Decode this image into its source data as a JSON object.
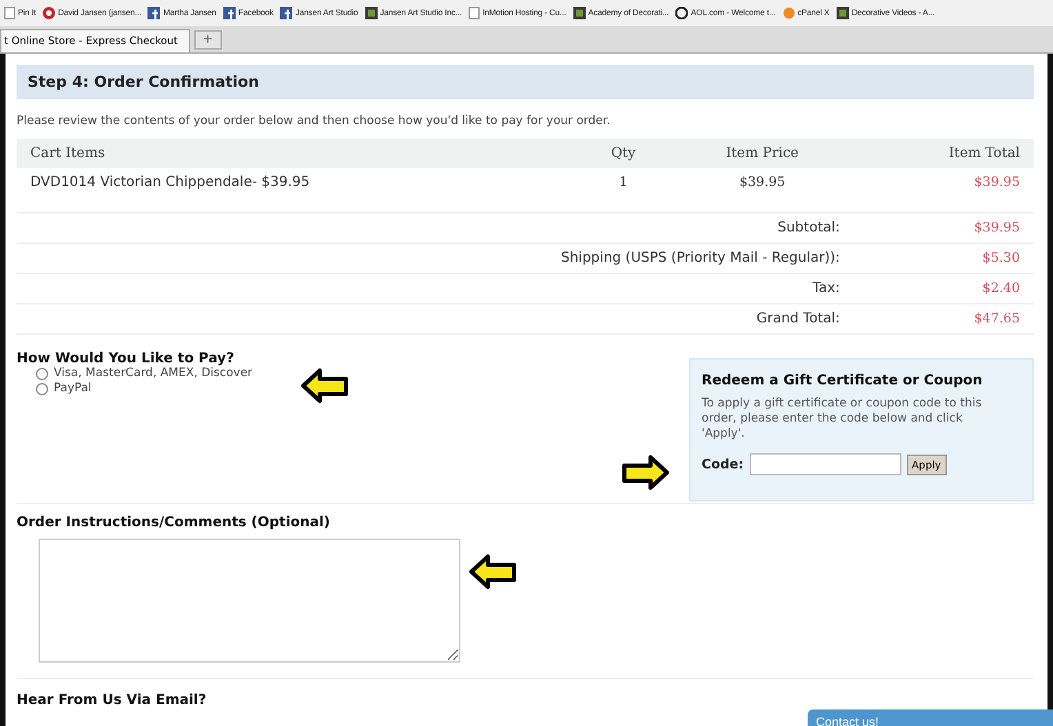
{
  "bookmarks": [
    {
      "label": "Pin It",
      "kind": "blank"
    },
    {
      "label": "David Jansen (jansen...",
      "kind": "pin"
    },
    {
      "label": "Martha Jansen",
      "kind": "facebook"
    },
    {
      "label": "Facebook",
      "kind": "facebook"
    },
    {
      "label": "Jansen Art Studio",
      "kind": "facebook"
    },
    {
      "label": "Jansen Art Studio Inc...",
      "kind": "site"
    },
    {
      "label": "InMotion Hosting - Cu...",
      "kind": "blank"
    },
    {
      "label": "Academy of Decorati...",
      "kind": "site"
    },
    {
      "label": "AOL.com - Welcome t...",
      "kind": "aol"
    },
    {
      "label": "cPanel X",
      "kind": "cpanel"
    },
    {
      "label": "Decorative Videos - A...",
      "kind": "site"
    }
  ],
  "tabs": [
    {
      "label": "t Online Store - Express Checkout",
      "selected": true
    }
  ],
  "new_tab": "+",
  "step_title": "Step 4: Order Confirmation",
  "intro": "Please review the contents of your order below and then choose how you'd like to pay for your order.",
  "cart": {
    "columns": [
      "Cart Items",
      "Qty",
      "Item Price",
      "Item Total"
    ],
    "rows": [
      {
        "item": "DVD1014 Victorian Chippendale- $39.95",
        "qty": "1",
        "price": "$39.95",
        "total": "$39.95"
      }
    ],
    "totals": [
      {
        "label": "Subtotal:",
        "value": "$39.95"
      },
      {
        "label": "Shipping (USPS (Priority Mail - Regular)):",
        "value": "$5.30"
      },
      {
        "label": "Tax:",
        "value": "$2.40"
      },
      {
        "label": "Grand Total:",
        "value": "$47.65"
      }
    ]
  },
  "payment": {
    "title": "How Would You Like to Pay?",
    "options": [
      {
        "label": "Visa, MasterCard, AMEX, Discover",
        "selected": false
      },
      {
        "label": "PayPal",
        "selected": false
      }
    ]
  },
  "coupon": {
    "title": "Redeem a Gift Certificate or Coupon",
    "text": "To apply a gift certificate or coupon code to this order, please enter the code below and click 'Apply'.",
    "code_label": "Code:",
    "button": "Apply"
  },
  "comments": {
    "title": "Order Instructions/Comments (Optional)"
  },
  "email": {
    "title": "Hear From Us Via Email?"
  },
  "contact": "Contact us!"
}
